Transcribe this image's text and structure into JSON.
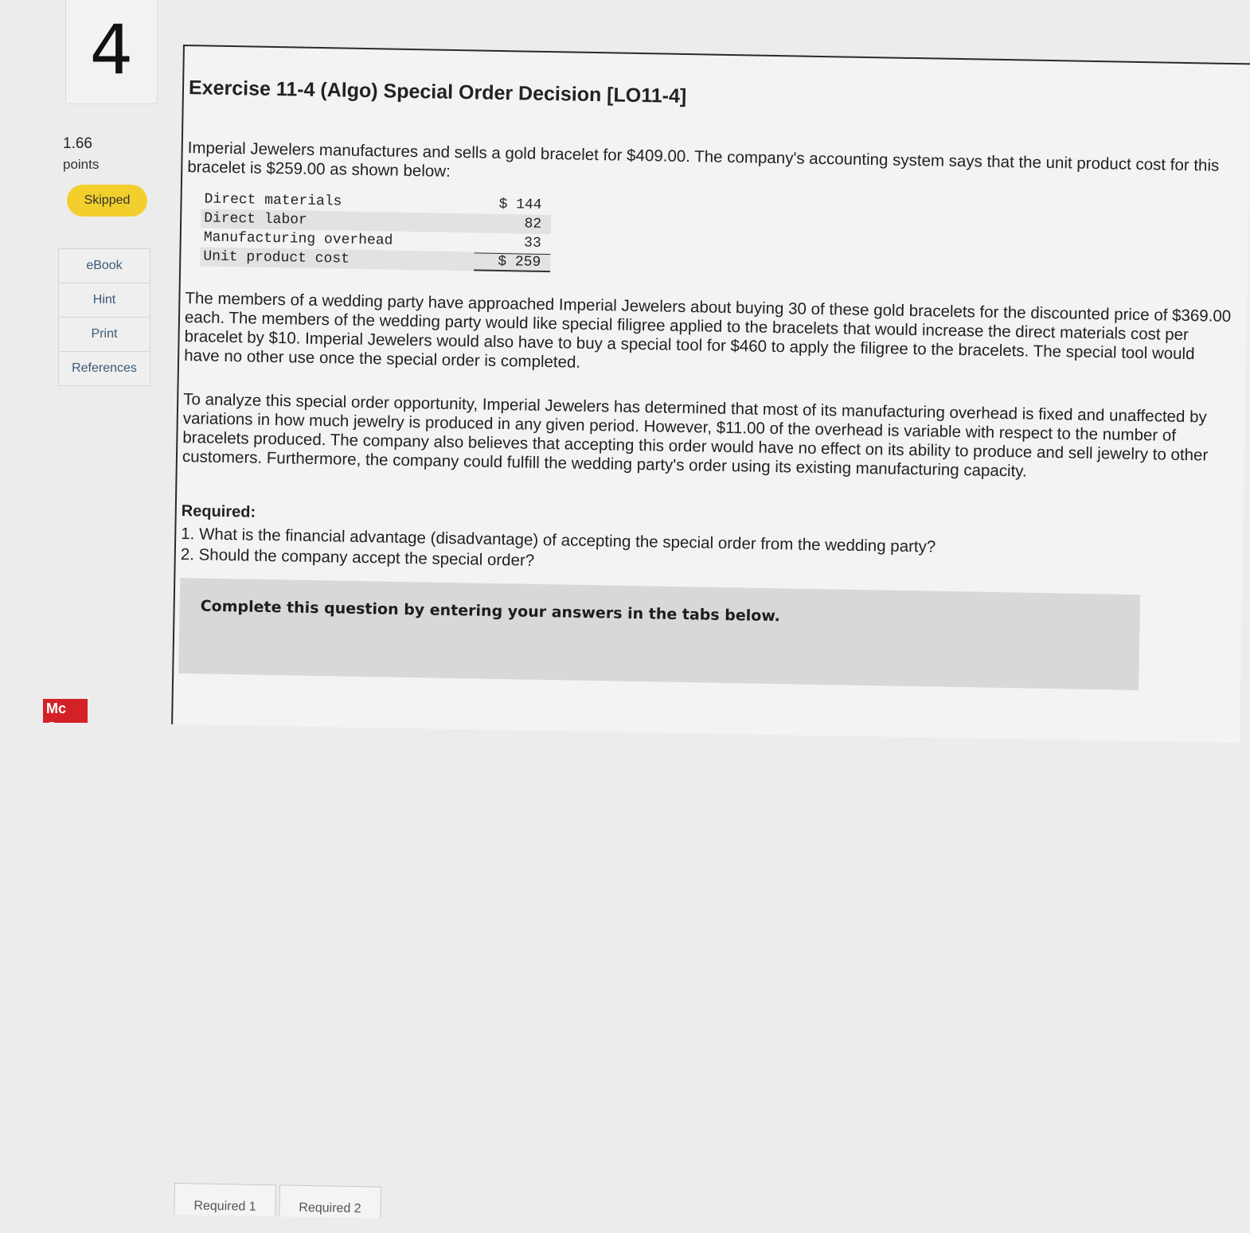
{
  "question": {
    "number": "4",
    "points_value": "1.66",
    "points_label": "points",
    "status": "Skipped"
  },
  "tools": [
    {
      "label": "eBook"
    },
    {
      "label": "Hint"
    },
    {
      "label": "Print"
    },
    {
      "label": "References"
    }
  ],
  "brand": {
    "logo_text": "Mc Graw"
  },
  "exercise": {
    "title": "Exercise 11-4 (Algo) Special Order Decision [LO11-4]",
    "intro": "Imperial Jewelers manufactures and sells a gold bracelet for $409.00. The company's accounting system says that the unit product cost for this bracelet is $259.00 as shown below:",
    "cost_table": [
      {
        "label": "Direct materials",
        "value": "$ 144"
      },
      {
        "label": "Direct labor",
        "value": "82"
      },
      {
        "label": "Manufacturing overhead",
        "value": "33"
      },
      {
        "label": "Unit product cost",
        "value": "$ 259"
      }
    ],
    "paragraph_2": "The members of a wedding party have approached Imperial Jewelers about buying 30 of these gold bracelets for the discounted price of $369.00 each. The members of the wedding party would like special filigree applied to the bracelets that would increase the direct materials cost per bracelet by $10. Imperial Jewelers would also have to buy a special tool for $460 to apply the filigree to the bracelets. The special tool would have no other use once the special order is completed.",
    "paragraph_3": "To analyze this special order opportunity, Imperial Jewelers has determined that most of its manufacturing overhead is fixed and unaffected by variations in how much jewelry is produced in any given period. However, $11.00 of the overhead is variable with respect to the number of bracelets produced. The company also believes that accepting this order would have no effect on its ability to produce and sell jewelry to other customers. Furthermore, the company could fulfill the wedding party's order using its existing manufacturing capacity.",
    "required_heading": "Required:",
    "required_items": [
      "1. What is the financial advantage (disadvantage) of accepting the special order from the wedding party?",
      "2. Should the company accept the special order?"
    ],
    "instructions": "Complete this question by entering your answers in the tabs below.",
    "tabs": [
      {
        "label": "Required 1"
      },
      {
        "label": "Required 2"
      }
    ]
  }
}
